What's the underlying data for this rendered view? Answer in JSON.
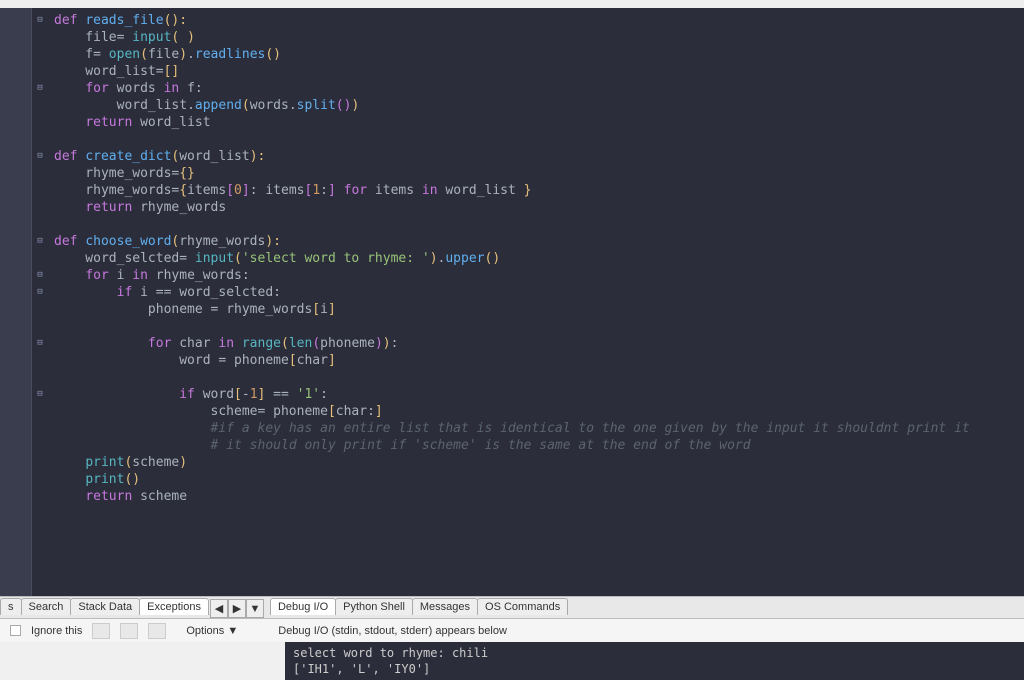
{
  "code": {
    "lines": [
      {
        "fold": true,
        "tokens": [
          [
            "kw",
            "def "
          ],
          [
            "fn",
            "reads_file"
          ],
          [
            "par",
            "():"
          ]
        ]
      },
      {
        "tokens": [
          [
            "id",
            "    file"
          ],
          [
            "op",
            "= "
          ],
          [
            "bi",
            "input"
          ],
          [
            "par",
            "( )"
          ]
        ]
      },
      {
        "tokens": [
          [
            "id",
            "    f"
          ],
          [
            "op",
            "= "
          ],
          [
            "bi",
            "open"
          ],
          [
            "par",
            "("
          ],
          [
            "id",
            "file"
          ],
          [
            "par",
            ")"
          ],
          [
            "op",
            "."
          ],
          [
            "fn",
            "readlines"
          ],
          [
            "par",
            "()"
          ]
        ]
      },
      {
        "tokens": [
          [
            "id",
            "    word_list"
          ],
          [
            "op",
            "="
          ],
          [
            "par",
            "[]"
          ]
        ]
      },
      {
        "fold": true,
        "tokens": [
          [
            "id",
            "    "
          ],
          [
            "kw",
            "for"
          ],
          [
            "id",
            " words "
          ],
          [
            "kw",
            "in"
          ],
          [
            "id",
            " f"
          ],
          [
            "op",
            ":"
          ]
        ]
      },
      {
        "tokens": [
          [
            "id",
            "        word_list"
          ],
          [
            "op",
            "."
          ],
          [
            "fn",
            "append"
          ],
          [
            "par",
            "("
          ],
          [
            "id",
            "words"
          ],
          [
            "op",
            "."
          ],
          [
            "fn",
            "split"
          ],
          [
            "par2",
            "()"
          ],
          [
            "par",
            ")"
          ]
        ]
      },
      {
        "tokens": [
          [
            "id",
            "    "
          ],
          [
            "kw",
            "return"
          ],
          [
            "id",
            " word_list"
          ]
        ]
      },
      {
        "tokens": [
          [
            "id",
            ""
          ]
        ]
      },
      {
        "fold": true,
        "tokens": [
          [
            "kw",
            "def "
          ],
          [
            "fn",
            "create_dict"
          ],
          [
            "par",
            "("
          ],
          [
            "id",
            "word_list"
          ],
          [
            "par",
            "):"
          ]
        ]
      },
      {
        "tokens": [
          [
            "id",
            "    rhyme_words"
          ],
          [
            "op",
            "="
          ],
          [
            "par",
            "{}"
          ]
        ]
      },
      {
        "tokens": [
          [
            "id",
            "    rhyme_words"
          ],
          [
            "op",
            "="
          ],
          [
            "par",
            "{"
          ],
          [
            "id",
            "items"
          ],
          [
            "par2",
            "["
          ],
          [
            "num",
            "0"
          ],
          [
            "par2",
            "]"
          ],
          [
            "op",
            ": "
          ],
          [
            "id",
            "items"
          ],
          [
            "par2",
            "["
          ],
          [
            "num",
            "1"
          ],
          [
            "op",
            ":"
          ],
          [
            "par2",
            "]"
          ],
          [
            "id",
            " "
          ],
          [
            "kw",
            "for"
          ],
          [
            "id",
            " items "
          ],
          [
            "kw",
            "in"
          ],
          [
            "id",
            " word_list "
          ],
          [
            "par",
            "}"
          ]
        ]
      },
      {
        "tokens": [
          [
            "id",
            "    "
          ],
          [
            "kw",
            "return"
          ],
          [
            "id",
            " rhyme_words"
          ]
        ]
      },
      {
        "tokens": [
          [
            "id",
            ""
          ]
        ]
      },
      {
        "fold": true,
        "tokens": [
          [
            "kw",
            "def "
          ],
          [
            "fn",
            "choose_word"
          ],
          [
            "par",
            "("
          ],
          [
            "id",
            "rhyme_words"
          ],
          [
            "par",
            "):"
          ]
        ]
      },
      {
        "tokens": [
          [
            "id",
            "    word_selcted"
          ],
          [
            "op",
            "= "
          ],
          [
            "bi",
            "input"
          ],
          [
            "par",
            "("
          ],
          [
            "str",
            "'select word to rhyme: '"
          ],
          [
            "par",
            ")"
          ],
          [
            "op",
            "."
          ],
          [
            "fn",
            "upper"
          ],
          [
            "par",
            "()"
          ]
        ]
      },
      {
        "fold": true,
        "tokens": [
          [
            "id",
            "    "
          ],
          [
            "kw",
            "for"
          ],
          [
            "id",
            " i "
          ],
          [
            "kw",
            "in"
          ],
          [
            "id",
            " rhyme_words"
          ],
          [
            "op",
            ":"
          ]
        ]
      },
      {
        "fold": true,
        "tokens": [
          [
            "id",
            "        "
          ],
          [
            "kw",
            "if"
          ],
          [
            "id",
            " i "
          ],
          [
            "op",
            "=="
          ],
          [
            "id",
            " word_selcted"
          ],
          [
            "op",
            ":"
          ]
        ]
      },
      {
        "tokens": [
          [
            "id",
            "            phoneme "
          ],
          [
            "op",
            "="
          ],
          [
            "id",
            " rhyme_words"
          ],
          [
            "par",
            "["
          ],
          [
            "id",
            "i"
          ],
          [
            "par",
            "]"
          ]
        ]
      },
      {
        "tokens": [
          [
            "id",
            ""
          ]
        ]
      },
      {
        "fold": true,
        "tokens": [
          [
            "id",
            "            "
          ],
          [
            "kw",
            "for"
          ],
          [
            "id",
            " char "
          ],
          [
            "kw",
            "in"
          ],
          [
            "id",
            " "
          ],
          [
            "bi",
            "range"
          ],
          [
            "par",
            "("
          ],
          [
            "bi",
            "len"
          ],
          [
            "par2",
            "("
          ],
          [
            "id",
            "phoneme"
          ],
          [
            "par2",
            ")"
          ],
          [
            "par",
            ")"
          ],
          [
            "op",
            ":"
          ]
        ]
      },
      {
        "tokens": [
          [
            "id",
            "                word "
          ],
          [
            "op",
            "="
          ],
          [
            "id",
            " phoneme"
          ],
          [
            "par",
            "["
          ],
          [
            "id",
            "char"
          ],
          [
            "par",
            "]"
          ]
        ]
      },
      {
        "tokens": [
          [
            "id",
            ""
          ]
        ]
      },
      {
        "fold": true,
        "tokens": [
          [
            "id",
            "                "
          ],
          [
            "kw",
            "if"
          ],
          [
            "id",
            " word"
          ],
          [
            "par",
            "["
          ],
          [
            "op",
            "-"
          ],
          [
            "num",
            "1"
          ],
          [
            "par",
            "]"
          ],
          [
            "id",
            " "
          ],
          [
            "op",
            "=="
          ],
          [
            "id",
            " "
          ],
          [
            "str",
            "'1'"
          ],
          [
            "op",
            ":"
          ]
        ]
      },
      {
        "tokens": [
          [
            "id",
            "                    scheme"
          ],
          [
            "op",
            "="
          ],
          [
            "id",
            " phoneme"
          ],
          [
            "par",
            "["
          ],
          [
            "id",
            "char"
          ],
          [
            "op",
            ":"
          ],
          [
            "par",
            "]"
          ]
        ]
      },
      {
        "tokens": [
          [
            "id",
            "                    "
          ],
          [
            "cmt",
            "#if a key has an entire list that is identical to the one given by the input it shouldnt print it"
          ]
        ]
      },
      {
        "tokens": [
          [
            "id",
            "                    "
          ],
          [
            "cmt",
            "# it should only print if 'scheme' is the same at the end of the word"
          ]
        ]
      },
      {
        "tokens": [
          [
            "id",
            "    "
          ],
          [
            "bi",
            "print"
          ],
          [
            "par",
            "("
          ],
          [
            "id",
            "scheme"
          ],
          [
            "par",
            ")"
          ]
        ]
      },
      {
        "tokens": [
          [
            "id",
            "    "
          ],
          [
            "bi",
            "print"
          ],
          [
            "par",
            "()"
          ]
        ]
      },
      {
        "tokens": [
          [
            "id",
            "    "
          ],
          [
            "kw",
            "return"
          ],
          [
            "id",
            " scheme"
          ]
        ]
      }
    ]
  },
  "debug": {
    "tabs_left": [
      "s",
      "Search",
      "Stack Data",
      "Exceptions"
    ],
    "tabs_right": [
      "Debug I/O",
      "Python Shell",
      "Messages",
      "OS Commands"
    ],
    "active_left": "Exceptions",
    "active_right": "Debug I/O",
    "ignore_label": "Ignore this",
    "options_label": "Options",
    "io_hint": "Debug I/O (stdin, stdout, stderr) appears below",
    "console_line1": "select word to rhyme: chili",
    "console_line2": "['IH1', 'L', 'IY0']"
  }
}
